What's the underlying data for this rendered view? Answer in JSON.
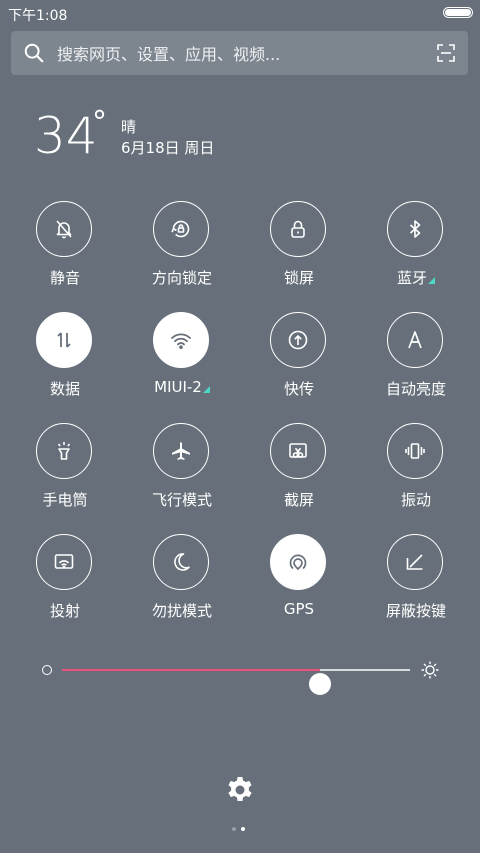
{
  "status_bar": {
    "time": "下午1:08"
  },
  "search": {
    "placeholder": "搜索网页、设置、应用、视频..."
  },
  "weather": {
    "temperature": "34",
    "degree": "°",
    "condition": "晴",
    "date": "6月18日 周日"
  },
  "tiles": [
    {
      "label": "静音",
      "icon": "bell-off-icon",
      "active": false
    },
    {
      "label": "方向锁定",
      "icon": "rotation-lock-icon",
      "active": false
    },
    {
      "label": "锁屏",
      "icon": "lock-icon",
      "active": false
    },
    {
      "label": "蓝牙",
      "icon": "bluetooth-icon",
      "active": false
    },
    {
      "label": "数据",
      "icon": "data-arrows-icon",
      "active": true
    },
    {
      "label": "MIUI-2",
      "icon": "wifi-icon",
      "active": true
    },
    {
      "label": "快传",
      "icon": "transfer-icon",
      "active": false
    },
    {
      "label": "自动亮度",
      "icon": "auto-brightness-icon",
      "active": false
    },
    {
      "label": "手电筒",
      "icon": "flashlight-icon",
      "active": false
    },
    {
      "label": "飞行模式",
      "icon": "airplane-icon",
      "active": false
    },
    {
      "label": "截屏",
      "icon": "screenshot-icon",
      "active": false
    },
    {
      "label": "振动",
      "icon": "vibrate-icon",
      "active": false
    },
    {
      "label": "投射",
      "icon": "cast-icon",
      "active": false
    },
    {
      "label": "勿扰模式",
      "icon": "moon-icon",
      "active": false
    },
    {
      "label": "GPS",
      "icon": "gps-icon",
      "active": true
    },
    {
      "label": "屏蔽按键",
      "icon": "keys-off-icon",
      "active": false
    }
  ],
  "brightness": {
    "level": 0.74
  },
  "pager": {
    "pages": 2,
    "current": 2
  },
  "colors": {
    "background": "#67707a",
    "slider_fill": "#e9517c",
    "signal_triangle": "#4fd6c5"
  }
}
